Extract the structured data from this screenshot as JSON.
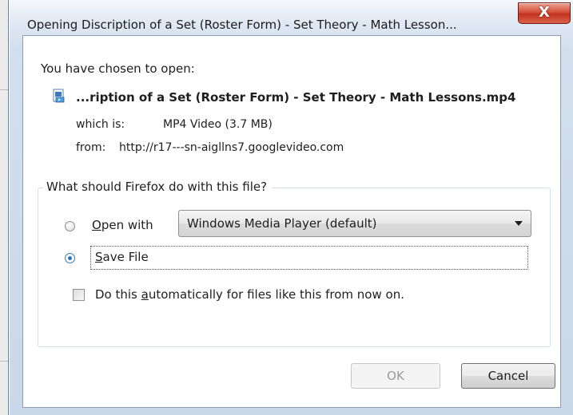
{
  "window": {
    "title": "Opening Discription of a Set (Roster Form) - Set Theory - Math Lesson...",
    "close_glyph": "X"
  },
  "dialog": {
    "prompt": "You have chosen to open:",
    "file_icon": "video-file-icon",
    "file_name": "...ription of a Set (Roster Form) - Set Theory - Math Lessons.mp4",
    "which_label": "which is:",
    "which_value": "MP4 Video (3.7 MB)",
    "from_label": "from:",
    "from_value": "http://r17---sn-aigllns7.googlevideo.com",
    "group_title": "What should Firefox do with this file?",
    "open_with": {
      "label_accel": "O",
      "label_rest": "pen with",
      "selected": false
    },
    "app_select": {
      "value": "Windows Media Player (default)"
    },
    "save_file": {
      "label_accel": "S",
      "label_rest": "ave File",
      "selected": true
    },
    "auto_checkbox": {
      "label_before": "Do this ",
      "label_accel": "a",
      "label_after": "utomatically for files like this from now on.",
      "checked": false
    }
  },
  "buttons": {
    "ok": "OK",
    "cancel": "Cancel"
  },
  "colors": {
    "close_button": "#d5503b",
    "radio_selected": "#2f7bd0",
    "ok_disabled_text": "#9a9a9a"
  }
}
